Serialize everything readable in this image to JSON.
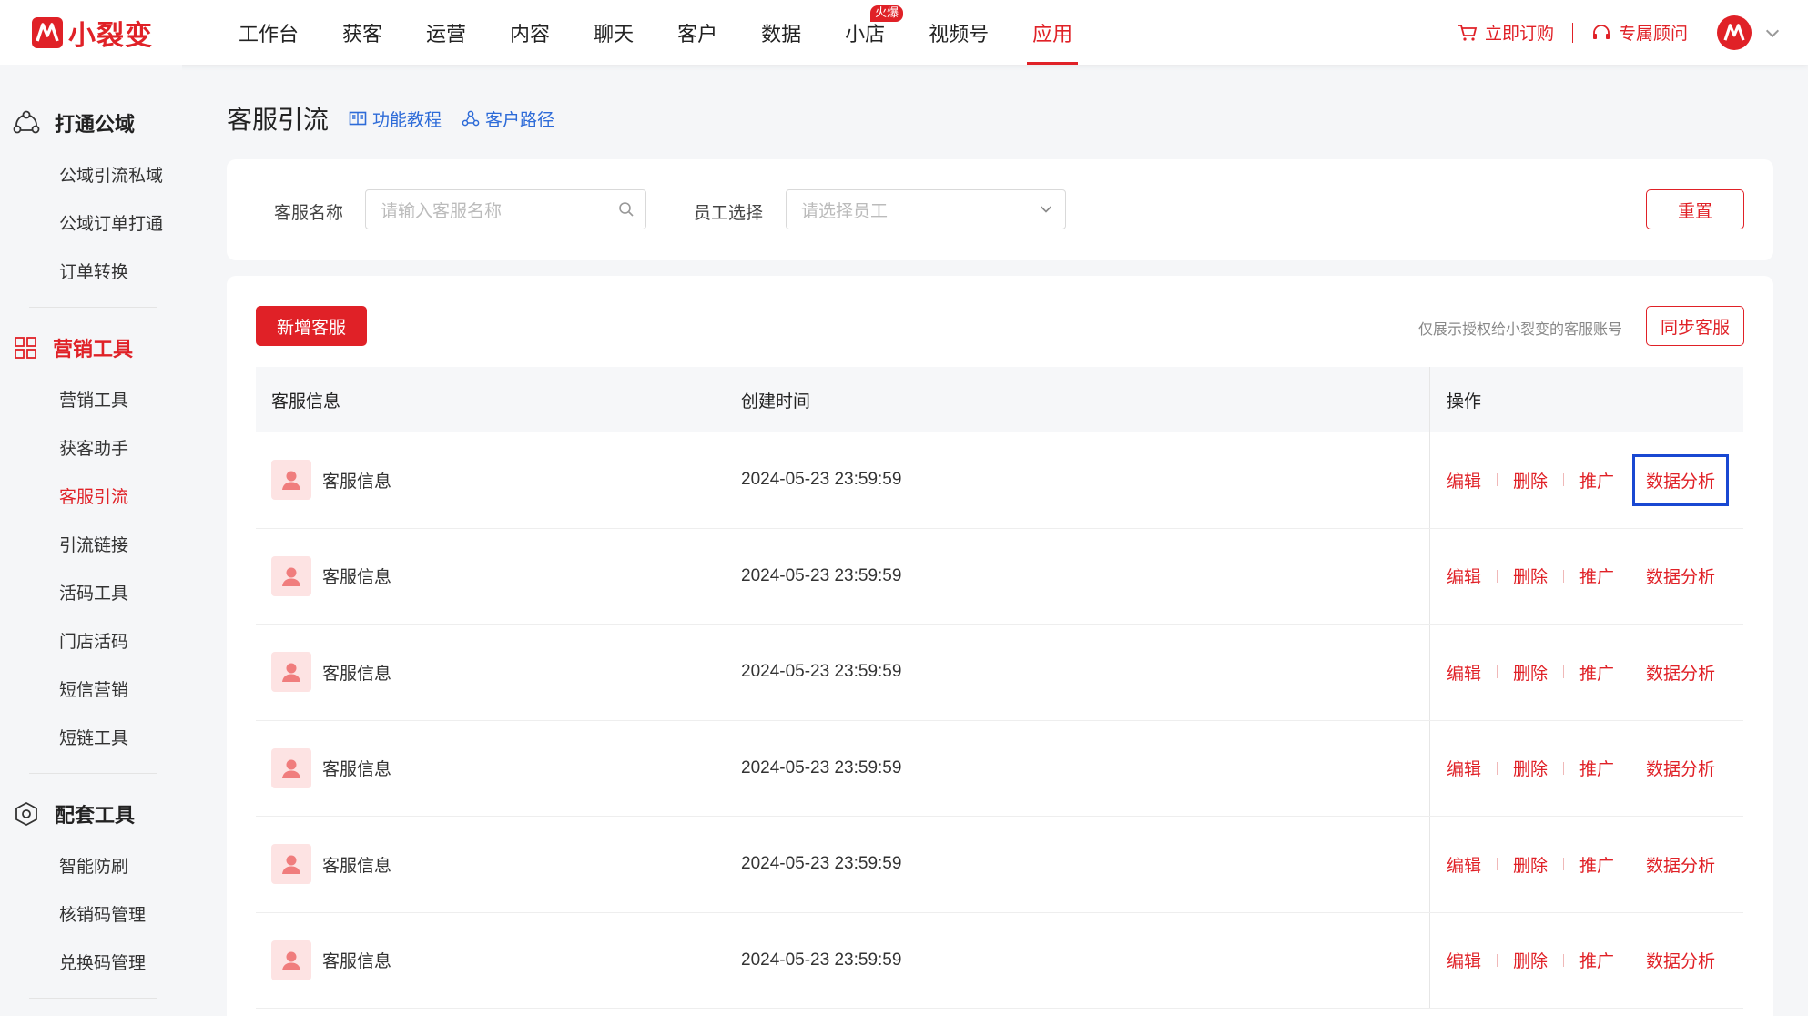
{
  "brand": {
    "name": "小裂变",
    "color": "#e02127"
  },
  "nav": {
    "items": [
      {
        "label": "工作台"
      },
      {
        "label": "获客"
      },
      {
        "label": "运营"
      },
      {
        "label": "内容"
      },
      {
        "label": "聊天"
      },
      {
        "label": "客户"
      },
      {
        "label": "数据"
      },
      {
        "label": "小店",
        "badge": "火爆"
      },
      {
        "label": "视频号"
      },
      {
        "label": "应用",
        "active": true
      }
    ],
    "subscribe": "立即订购",
    "advisor": "专属顾问"
  },
  "sidebar": {
    "groups": [
      {
        "title": "打通公域",
        "icon": "network-icon",
        "items": [
          "公域引流私域",
          "公域订单打通",
          "订单转换"
        ]
      },
      {
        "title": "营销工具",
        "icon": "grid-icon",
        "active": true,
        "items": [
          "营销工具",
          "获客助手",
          "客服引流",
          "引流链接",
          "活码工具",
          "门店活码",
          "短信营销",
          "短链工具"
        ]
      },
      {
        "title": "配套工具",
        "icon": "hexagon-icon",
        "items": [
          "智能防刷",
          "核销码管理",
          "兑换码管理"
        ]
      }
    ],
    "active_item": "客服引流"
  },
  "page": {
    "title": "客服引流",
    "tutorial_link": "功能教程",
    "path_link": "客户路径"
  },
  "filters": {
    "name_label": "客服名称",
    "name_placeholder": "请输入客服名称",
    "staff_label": "员工选择",
    "staff_placeholder": "请选择员工",
    "reset_label": "重置"
  },
  "list": {
    "add_button": "新增客服",
    "hint": "仅展示授权给小裂变的客服账号",
    "sync_button": "同步客服",
    "columns": [
      "客服信息",
      "创建时间",
      "操作"
    ],
    "actions": [
      "编辑",
      "删除",
      "推广",
      "数据分析"
    ],
    "rows": [
      {
        "name": "客服信息",
        "created": "2024-05-23 23:59:59"
      },
      {
        "name": "客服信息",
        "created": "2024-05-23 23:59:59"
      },
      {
        "name": "客服信息",
        "created": "2024-05-23 23:59:59"
      },
      {
        "name": "客服信息",
        "created": "2024-05-23 23:59:59"
      },
      {
        "name": "客服信息",
        "created": "2024-05-23 23:59:59"
      },
      {
        "name": "客服信息",
        "created": "2024-05-23 23:59:59"
      }
    ]
  }
}
